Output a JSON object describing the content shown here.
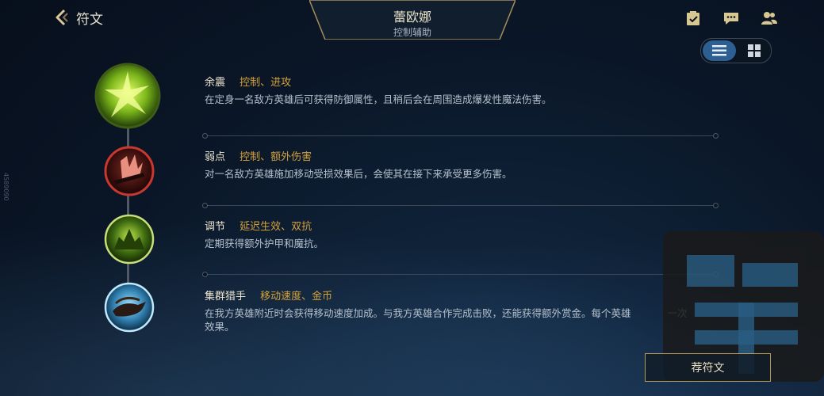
{
  "header": {
    "back_label": "符文",
    "champion_name": "蕾欧娜",
    "champion_role": "控制辅助",
    "icons": [
      "back-chevron-icon",
      "checklist-icon",
      "chat-icon",
      "friends-icon"
    ]
  },
  "view_toggle": {
    "active": "list",
    "options": [
      "list-view-icon",
      "grid-view-icon"
    ]
  },
  "runes": [
    {
      "name": "余震",
      "tags": "控制、进攻",
      "desc": "在定身一名敌方英雄后可获得防御属性，且稍后会在周围造成爆发性魔法伤害。",
      "icon": "aftershock-icon",
      "color": "#8cc61e"
    },
    {
      "name": "弱点",
      "tags": "控制、额外伤害",
      "desc": "对一名敌方英雄施加移动受损效果后，会使其在接下来承受更多伤害。",
      "icon": "cheap-shot-icon",
      "color": "#c8382f"
    },
    {
      "name": "调节",
      "tags": "延迟生效、双抗",
      "desc": "定期获得额外护甲和魔抗。",
      "icon": "conditioning-icon",
      "color": "#7cbd2a"
    },
    {
      "name": "集群猎手",
      "tags": "移动速度、金币",
      "desc": "在我方英雄附近时会获得移动速度加成。与我方英雄合作完成击败，还能获得额外赏金。每个英雄",
      "desc_tail": "一次",
      "desc2": "效果。",
      "icon": "ultimate-hunter-icon",
      "color": "#4fb0d8"
    }
  ],
  "recommend_button": "荐符文",
  "side_text": "4589090",
  "colors": {
    "accent_gold": "#d4a23a",
    "toggle_active": "#2d5f93",
    "button_border": "#b69a5a"
  }
}
